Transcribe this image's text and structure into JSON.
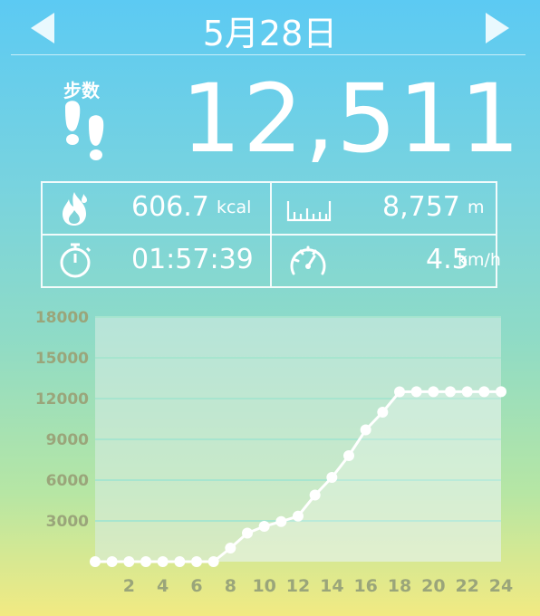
{
  "header": {
    "date": "5月28日",
    "prev_label": "previous-day",
    "next_label": "next-day"
  },
  "steps": {
    "label": "步数",
    "value": "12,511"
  },
  "stats": {
    "calories": {
      "value": "606.7",
      "unit": "kcal",
      "icon": "flame-icon"
    },
    "distance": {
      "value": "8,757",
      "unit": "m",
      "icon": "ruler-icon"
    },
    "duration": {
      "value": "01:57:39",
      "icon": "stopwatch-icon"
    },
    "speed": {
      "value": "4.5",
      "unit": "km/h",
      "icon": "speedometer-icon"
    }
  },
  "colors": {
    "text": "#ffffff",
    "axis_label": "#9aa57a",
    "grid": "#a7e5cf",
    "plot_bg": "#dbece6"
  },
  "chart_data": {
    "type": "line",
    "title": "",
    "xlabel": "",
    "ylabel": "",
    "x": [
      0,
      1,
      2,
      3,
      4,
      5,
      6,
      7,
      8,
      9,
      10,
      11,
      12,
      13,
      14,
      15,
      16,
      17,
      18,
      19,
      20,
      21,
      22,
      23,
      24
    ],
    "values": [
      0,
      0,
      0,
      0,
      0,
      0,
      0,
      0,
      1000,
      2100,
      2600,
      2950,
      3350,
      4900,
      6200,
      7800,
      9700,
      11000,
      12500,
      12511,
      12511,
      12511,
      12511,
      12511,
      12511
    ],
    "xticks": [
      "2",
      "4",
      "6",
      "8",
      "10",
      "12",
      "14",
      "16",
      "18",
      "20",
      "22",
      "24"
    ],
    "xtick_values": [
      2,
      4,
      6,
      8,
      10,
      12,
      14,
      16,
      18,
      20,
      22,
      24
    ],
    "yticks": [
      "3000",
      "6000",
      "9000",
      "12000",
      "15000",
      "18000"
    ],
    "ytick_values": [
      3000,
      6000,
      9000,
      12000,
      15000,
      18000
    ],
    "xlim": [
      0,
      24
    ],
    "ylim": [
      0,
      18000
    ],
    "grid": true
  }
}
